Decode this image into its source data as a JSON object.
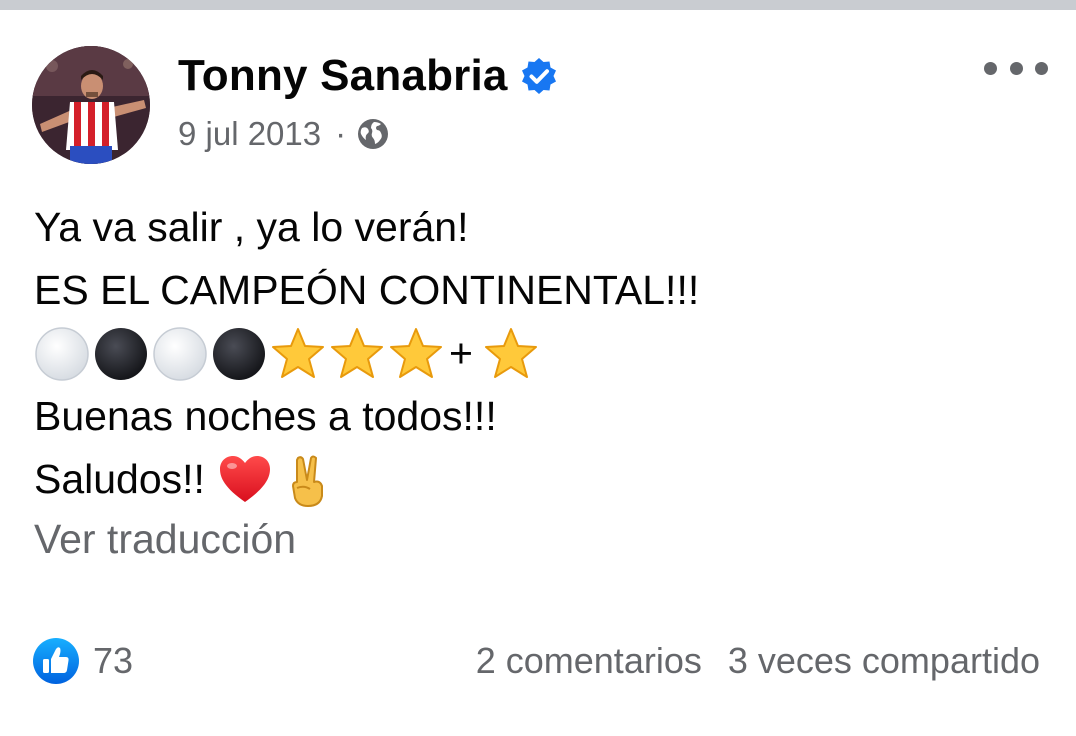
{
  "post": {
    "author": "Tonny Sanabria",
    "date": "9 jul 2013",
    "separator": "·",
    "audience_icon": "globe-icon",
    "verified_icon": "verified-badge-icon",
    "more_icon": "more-options-icon",
    "lines": [
      "Ya va salir , ya lo verán!",
      "ES EL CAMPEÓN CONTINENTAL!!!",
      "Buenas noches a todos!!!",
      "Saludos!!"
    ],
    "emoji_line": {
      "icons": [
        "white-circle-emoji",
        "black-circle-emoji",
        "white-circle-emoji",
        "black-circle-emoji",
        "star-emoji",
        "star-emoji",
        "star-emoji",
        "plus-sign",
        "star-emoji"
      ],
      "plus": "+"
    },
    "greeting_emojis": [
      "red-heart-emoji",
      "victory-hand-emoji"
    ],
    "translate_label": "Ver traducción"
  },
  "footer": {
    "reaction_icon": "like-icon",
    "reaction_count": "73",
    "comments": "2 comentarios",
    "shares": "3 veces compartido"
  },
  "colors": {
    "primary_text": "#050505",
    "secondary_text": "#65676b",
    "facebook_blue": "#1877f2",
    "divider": "#c9ccd1"
  }
}
